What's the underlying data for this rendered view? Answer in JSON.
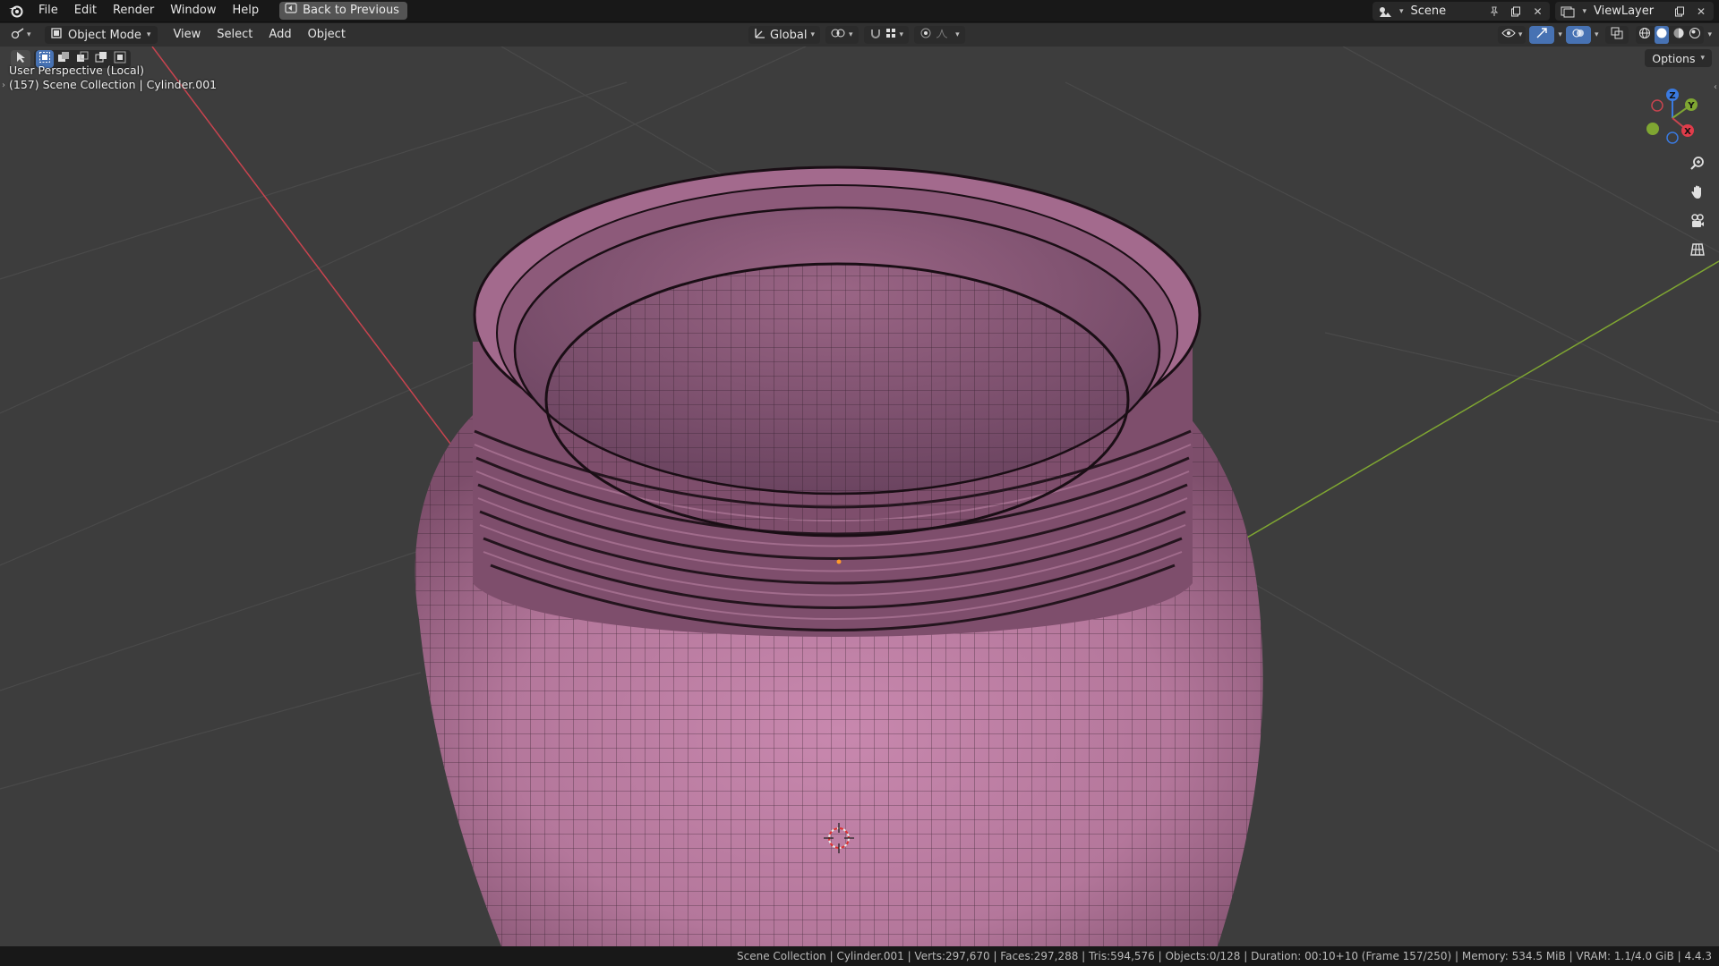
{
  "topbar": {
    "menus": [
      "File",
      "Edit",
      "Render",
      "Window",
      "Help"
    ],
    "back_button": "Back to Previous",
    "scene_name": "Scene",
    "view_layer": "ViewLayer"
  },
  "header": {
    "mode": "Object Mode",
    "menus": [
      "View",
      "Select",
      "Add",
      "Object"
    ],
    "transform_orientation": "Global"
  },
  "viewport": {
    "perspective": "User Perspective (Local)",
    "collection_info": "(157) Scene Collection | Cylinder.001",
    "options_label": "Options",
    "gizmo": {
      "z": "Z",
      "y": "Y",
      "x": "X"
    }
  },
  "statusbar": {
    "text": "Scene Collection | Cylinder.001 | Verts:297,670 | Faces:297,288 | Tris:594,576 | Objects:0/128 | Duration: 00:10+10 (Frame 157/250) | Memory: 534.5 MiB | VRAM: 1.1/4.0 GiB | 4.4.3"
  },
  "colors": {
    "accent": "#4772b3",
    "mesh_fill": "#b8799f",
    "x_axis": "#c8444f",
    "y_axis": "#7fa632",
    "z_axis": "#3a7ae0"
  },
  "icons": [
    "blender-logo-icon",
    "back-icon",
    "scene-icon",
    "pin-icon",
    "new-scene-icon",
    "close-icon",
    "view-layer-icon",
    "editor-type-icon",
    "object-mode-icon",
    "orientation-icon",
    "pivot-icon",
    "snap-icon",
    "proportional-icon",
    "visibility-icon",
    "gizmo-icon",
    "overlay-icon",
    "xray-icon",
    "wireframe-shading-icon",
    "solid-shading-icon",
    "material-shading-icon",
    "rendered-shading-icon",
    "select-box-icon",
    "zoom-icon",
    "pan-hand-icon",
    "camera-icon",
    "grid-ortho-icon"
  ]
}
